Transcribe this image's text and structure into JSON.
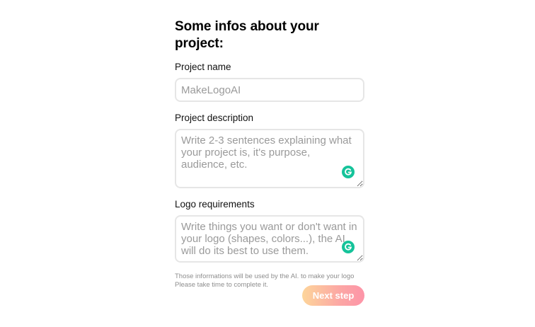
{
  "form": {
    "title": "Some infos about your project:",
    "project_name": {
      "label": "Project name",
      "placeholder": "MakeLogoAI",
      "value": ""
    },
    "project_description": {
      "label": "Project description",
      "placeholder": "Write 2-3 sentences explaining what your project is, it's purpose, audience, etc.",
      "value": ""
    },
    "logo_requirements": {
      "label": "Logo requirements",
      "placeholder": "Write things you want or don't want in your logo (shapes, colors...), the AI will do its best to use them.",
      "value": ""
    },
    "hint_line_1": "Those informations will be used by the AI. to make your logo",
    "hint_line_2": "Please take time to complete it.",
    "next_label": "Next step"
  },
  "icons": {
    "grammarly": "grammarly-icon"
  },
  "colors": {
    "grammarly_green": "#15c39a",
    "button_gradient_start": "#fdd59a",
    "button_gradient_end": "#fd94a8",
    "input_border": "#e6e6e6",
    "placeholder_text": "#9a9a9a"
  }
}
